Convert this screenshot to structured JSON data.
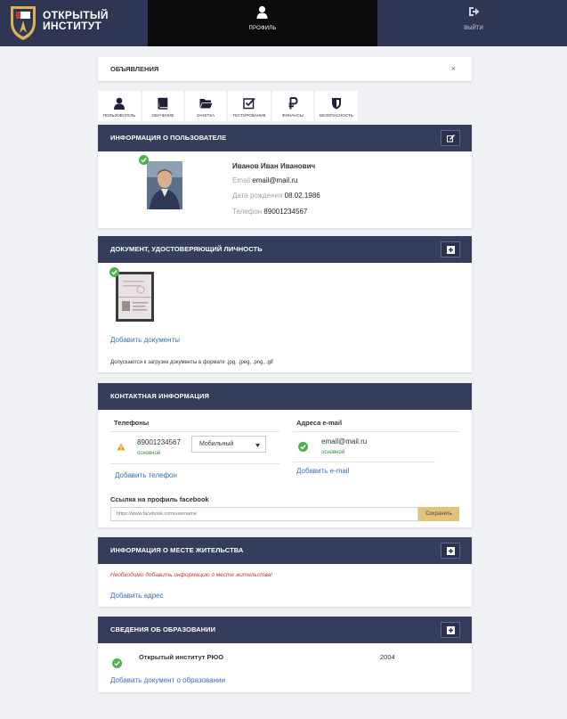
{
  "header": {
    "brand_line1": "ОТКРЫТЫЙ",
    "brand_line2": "ИНСТИТУТ",
    "nav_profile": "ПРОФИЛЬ",
    "nav_exit": "ВЫЙТИ"
  },
  "announcements": {
    "title": "ОБЪЯВЛЕНИЯ",
    "close": "×"
  },
  "tabs": [
    {
      "label": "ПОЛЬЗОВАТЕЛЬ",
      "icon": "user-icon"
    },
    {
      "label": "ОБУЧЕНИЕ",
      "icon": "book-icon"
    },
    {
      "label": "ЗАЧЕТКА",
      "icon": "folder-icon"
    },
    {
      "label": "ТЕСТИРОВАНИЕ",
      "icon": "checkbox-icon"
    },
    {
      "label": "ФИНАНСЫ",
      "icon": "ruble-icon"
    },
    {
      "label": "БЕЗОПАСНОСТЬ",
      "icon": "shield-icon"
    }
  ],
  "user_info": {
    "title": "ИНФОРМАЦИЯ О ПОЛЬЗОВАТЕЛЕ",
    "name": "Иванов Иван Иванович",
    "email_label": "Email",
    "email": "email@mail.ru",
    "birth_label": "Дата рождения",
    "birth": "08.02.1986",
    "phone_label": "Телефон",
    "phone": "89001234567"
  },
  "id_document": {
    "title": "ДОКУМЕНТ, УДОСТОВЕРЯЮЩИЙ ЛИЧНОСТЬ",
    "add_link": "Добавить документы",
    "note": "Допускаются к загрузке документы в формате .jpg, .jpeg, .png, .gif"
  },
  "contacts": {
    "title": "КОНТАКТНАЯ ИНФОРМАЦИЯ",
    "phones_header": "Телефоны",
    "phone_number": "89001234567",
    "phone_status": "основной",
    "phone_type": "Мобильный",
    "add_phone": "Добавить телефон",
    "emails_header": "Адреса e-mail",
    "email": "email@mail.ru",
    "email_status": "основной",
    "add_email": "Добавить e-mail",
    "facebook_label": "Ссылка на профиль facebook",
    "facebook_placeholder": "https://www.facebook.com/username",
    "save_button": "Сохранить"
  },
  "residence": {
    "title": "ИНФОРМАЦИЯ О МЕСТЕ ЖИТЕЛЬСТВА",
    "warning": "Необходимо добавить информацию о месте жительства!",
    "add_link": "Добавить адрес"
  },
  "education": {
    "title": "СВЕДЕНИЯ ОБ ОБРАЗОВАНИИ",
    "institution": "Открытый институт РЮО",
    "year": "2004",
    "add_link": "Добавить документ о образовании"
  },
  "colors": {
    "navbar": "#2e3654",
    "panel_header": "#343d5c",
    "active_nav": "#0b0b0e",
    "link": "#3b6db8",
    "success": "#4db24a",
    "save_button": "#e3c27a",
    "warning_text": "#c0392b"
  }
}
